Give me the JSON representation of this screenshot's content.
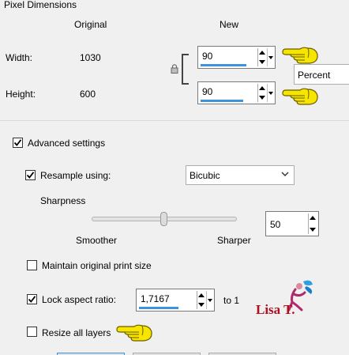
{
  "pixel_dimensions": {
    "title": "Pixel Dimensions",
    "col_original": "Original",
    "col_new": "New",
    "width_label": "Width:",
    "width_original": "1030",
    "width_new": "90",
    "height_label": "Height:",
    "height_original": "600",
    "height_new": "90",
    "unit": "Percent"
  },
  "advanced": {
    "label": "Advanced settings",
    "checked": true
  },
  "resample": {
    "label": "Resample using:",
    "checked": true,
    "method": "Bicubic"
  },
  "sharpness": {
    "label": "Sharpness",
    "left_label": "Smoother",
    "right_label": "Sharper",
    "value": "50",
    "level_percent": 50
  },
  "maintain_print": {
    "label": "Maintain original print size",
    "checked": false
  },
  "lock_aspect": {
    "label": "Lock aspect ratio:",
    "checked": true,
    "value": "1,7167",
    "suffix": "to 1"
  },
  "resize_layers": {
    "label": "Resize all layers",
    "checked": false
  },
  "watermark": {
    "text": "Lisa T."
  },
  "colors": {
    "accent_bar": "#3d94dc",
    "hand_yellow": "#f5e500",
    "watermark_red": "#b0101e"
  }
}
